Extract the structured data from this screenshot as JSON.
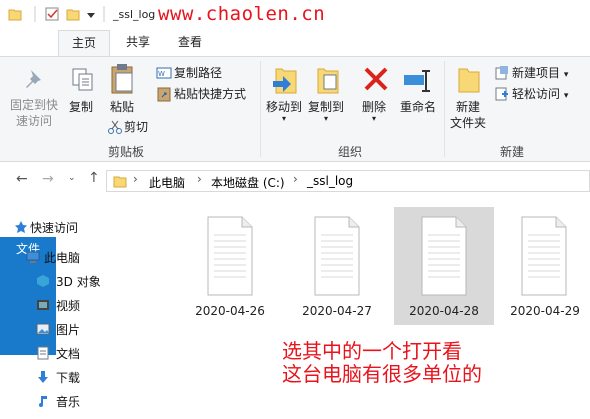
{
  "titlebar": {
    "path": "_ssl_log",
    "watermark": "www.chaolen.cn"
  },
  "tabs": [
    "文件",
    "主页",
    "共享",
    "查看"
  ],
  "ribbon": {
    "clipboard": {
      "pin": [
        "固定到快",
        "速访问"
      ],
      "copy": "复制",
      "paste": "粘贴",
      "copy_path": "复制路径",
      "paste_shortcut": "粘贴快捷方式",
      "cut": "剪切",
      "group": "剪贴板"
    },
    "organize": {
      "move_to": "移动到",
      "copy_to": "复制到",
      "delete": "删除",
      "rename": "重命名",
      "group": "组织"
    },
    "new": {
      "new_folder": [
        "新建",
        "文件夹"
      ],
      "new_item": "新建项目",
      "easy_access": "轻松访问",
      "group": "新建"
    }
  },
  "address": {
    "crumbs": [
      "此电脑",
      "本地磁盘 (C:)",
      "_ssl_log"
    ]
  },
  "nav": [
    "快速访问",
    "此电脑",
    "3D 对象",
    "视频",
    "图片",
    "文档",
    "下载",
    "音乐"
  ],
  "files": [
    "2020-04-26",
    "2020-04-27",
    "2020-04-28",
    "2020-04-29"
  ],
  "annotation": [
    "选其中的一个打开看",
    "这台电脑有很多单位的"
  ]
}
